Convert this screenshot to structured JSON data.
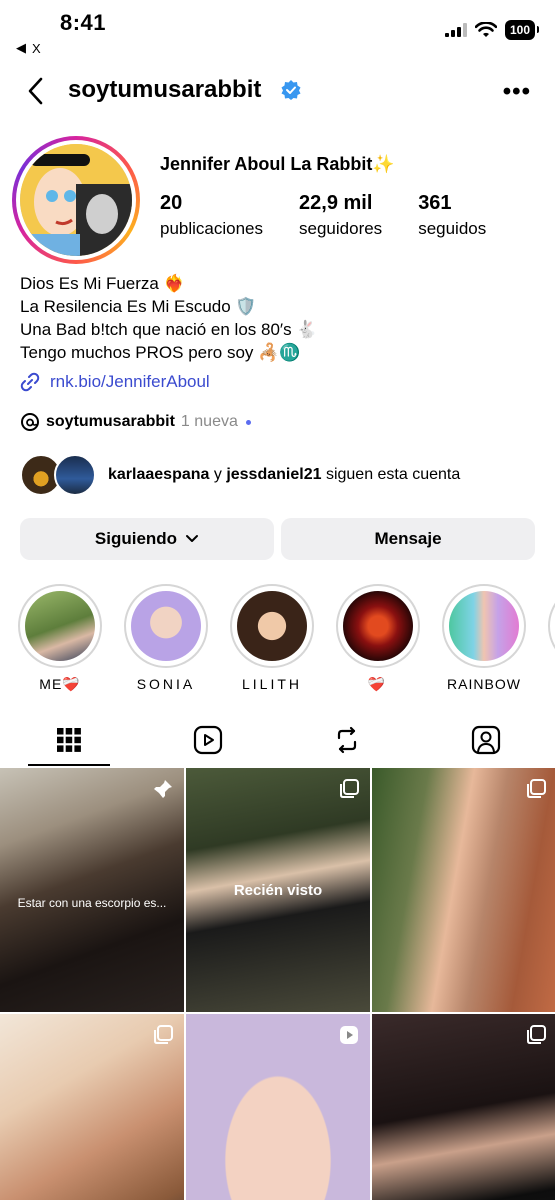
{
  "status_bar": {
    "time": "8:41",
    "back_app": "X",
    "battery": "100"
  },
  "header": {
    "username": "soytumusarabbit",
    "more": "•••"
  },
  "profile": {
    "display_name": "Jennifer Aboul La Rabbit✨",
    "stats": [
      {
        "value": "20",
        "label": "publicaciones"
      },
      {
        "value": "22,9 mil",
        "label": "seguidores"
      },
      {
        "value": "361",
        "label": "seguidos"
      }
    ],
    "bio": [
      "Dios Es Mi Fuerza ❤️‍🔥",
      "La Resilencia Es Mi Escudo 🛡️",
      "Una Bad b!tch que nació en los 80′s 🐇",
      "Tengo muchos PROS pero soy 🦂♏️"
    ],
    "link": "rnk.bio/JenniferAboul",
    "threads": {
      "handle": "soytumusarabbit",
      "badge": "1 nueva"
    },
    "followed_by": {
      "user1": "karlaaespana",
      "and": "y",
      "user2": "jessdaniel21",
      "suffix": "siguen esta cuenta"
    }
  },
  "actions": {
    "following": "Siguiendo",
    "message": "Mensaje"
  },
  "highlights": [
    {
      "label": "ME❤️‍🩹"
    },
    {
      "label": "SONIA"
    },
    {
      "label": "LILITH"
    },
    {
      "label": "❤️‍🩹"
    },
    {
      "label": "RAINBOW"
    }
  ],
  "grid": {
    "caption1": "Estar con una escorpio es...",
    "caption2": "Recién visto"
  }
}
